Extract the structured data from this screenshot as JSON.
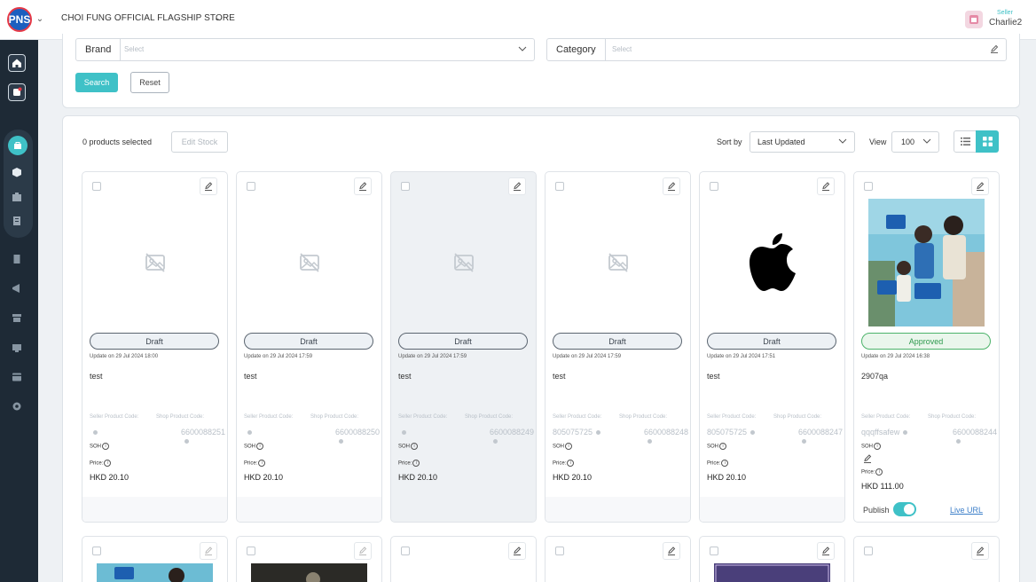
{
  "header": {
    "logo_text": "PNS",
    "store_name": "CHOI FUNG OFFICIAL FLAGSHIP STORE",
    "user_role": "Seller",
    "user_name": "Charlie2"
  },
  "sidebar": {
    "items": [
      {
        "icon": "home-icon"
      },
      {
        "icon": "notification-icon"
      },
      {
        "icon": "products-icon",
        "active": true
      },
      {
        "icon": "box-icon"
      },
      {
        "icon": "package-icon"
      },
      {
        "icon": "catalog-icon"
      },
      {
        "icon": "orders-icon"
      },
      {
        "icon": "promotion-icon"
      },
      {
        "icon": "store-icon"
      },
      {
        "icon": "shipping-icon"
      },
      {
        "icon": "finance-icon"
      },
      {
        "icon": "settings-icon"
      }
    ]
  },
  "filters": {
    "brand_label": "Brand",
    "brand_placeholder": "Select",
    "category_label": "Category",
    "category_placeholder": "Select",
    "search_label": "Search",
    "reset_label": "Reset"
  },
  "toolbar": {
    "selected_text": "0 products selected",
    "edit_stock_label": "Edit Stock",
    "sort_label": "Sort by",
    "sort_value": "Last Updated",
    "view_label": "View",
    "view_value": "100"
  },
  "products": [
    {
      "status": "Draft",
      "updated": "Update on 29 Jul 2024 18:00",
      "name": "test",
      "seller_code_label": "Seller Product Code:",
      "shop_code_label": "Shop Product Code:",
      "seller_code": "",
      "shop_code": "6600088251",
      "soh_label": "SOH",
      "price_label": "Price:",
      "price": "HKD 20.10"
    },
    {
      "status": "Draft",
      "updated": "Update on 29 Jul 2024 17:59",
      "name": "test",
      "seller_code_label": "Seller Product Code:",
      "shop_code_label": "Shop Product Code:",
      "seller_code": "",
      "shop_code": "6600088250",
      "soh_label": "SOH",
      "price_label": "Price:",
      "price": "HKD 20.10"
    },
    {
      "status": "Draft",
      "updated": "Update on 29 Jul 2024 17:59",
      "name": "test",
      "seller_code_label": "Seller Product Code:",
      "shop_code_label": "Shop Product Code:",
      "seller_code": "",
      "shop_code": "6600088249",
      "soh_label": "SOH",
      "price_label": "Price:",
      "price": "HKD 20.10"
    },
    {
      "status": "Draft",
      "updated": "Update on 29 Jul 2024 17:59",
      "name": "test",
      "seller_code_label": "Seller Product Code:",
      "shop_code_label": "Shop Product Code:",
      "seller_code": "805075725",
      "shop_code": "6600088248",
      "soh_label": "SOH",
      "price_label": "Price:",
      "price": "HKD 20.10"
    },
    {
      "status": "Draft",
      "updated": "Update on 29 Jul 2024 17:51",
      "name": "test",
      "seller_code_label": "Seller Product Code:",
      "shop_code_label": "Shop Product Code:",
      "seller_code": "805075725",
      "shop_code": "6600088247",
      "soh_label": "SOH",
      "price_label": "Price:",
      "price": "HKD 20.10"
    },
    {
      "status": "Approved",
      "updated": "Update on 29 Jul 2024 16:38",
      "name": "2907qa",
      "seller_code_label": "Seller Product Code:",
      "shop_code_label": "Shop Product Code:",
      "seller_code": "qqqffsafew",
      "shop_code": "6600088244",
      "soh_label": "SOH",
      "price_label": "Price:",
      "price": "HKD 111.00",
      "publish_label": "Publish",
      "live_url_label": "Live URL"
    }
  ],
  "colors": {
    "accent": "#3fc1c7",
    "sidebar_bg": "#1e2a36",
    "approved": "#4cb36a",
    "link": "#3a7dc8"
  }
}
